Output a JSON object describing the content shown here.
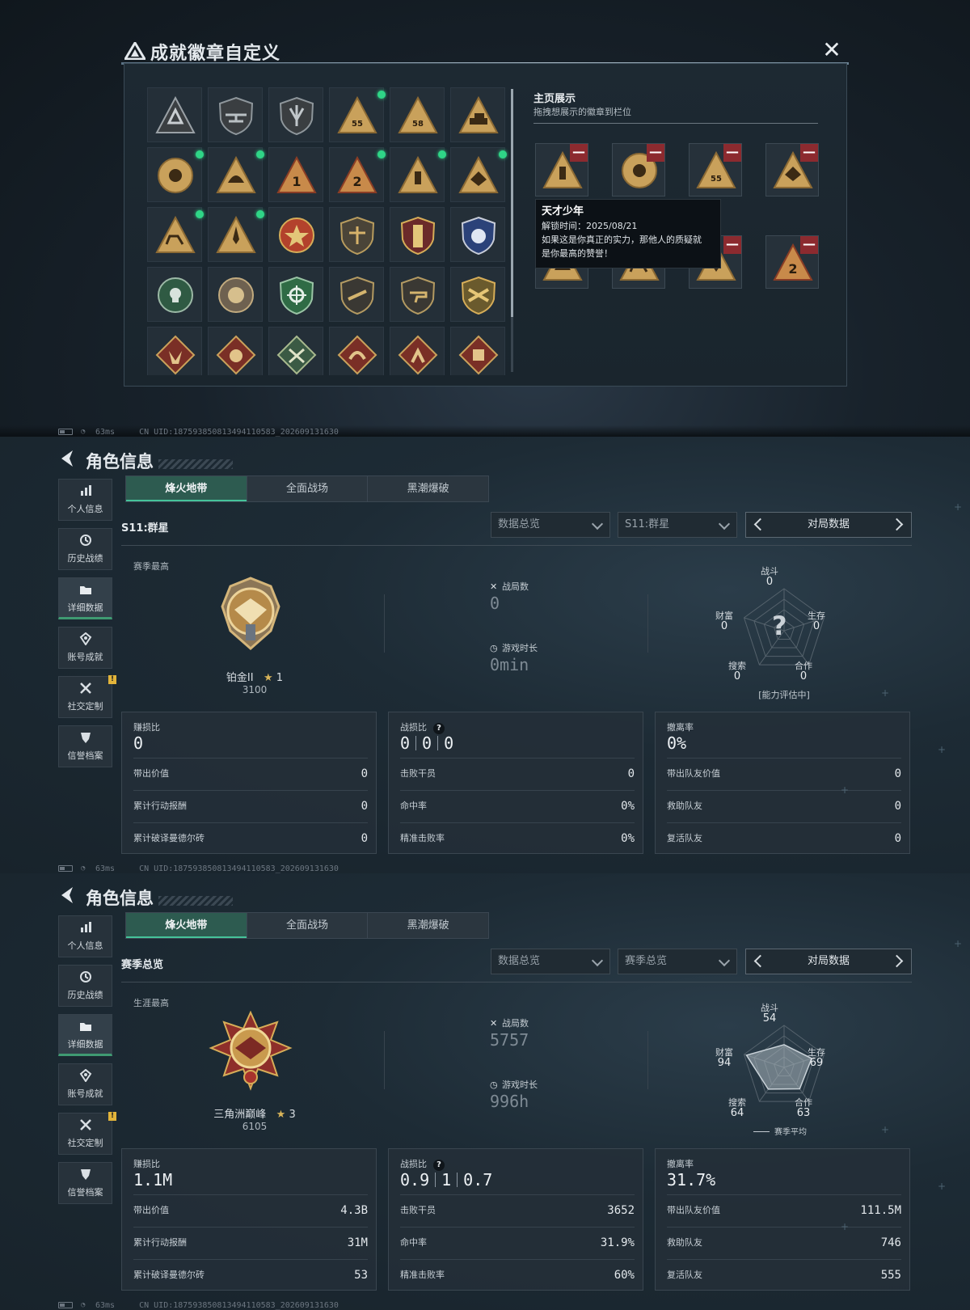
{
  "badge_modal": {
    "title": "成就徽章自定义",
    "showcase_title": "主页展示",
    "showcase_hint": "拖拽想展示的徽章到栏位",
    "tooltip": {
      "name": "天才少年",
      "unlock_time": "解锁时间：2025/08/21",
      "desc_line1": "如果这是你真正的实力，那他人的质疑就",
      "desc_line2": "是你最高的赞誉！"
    },
    "remove_glyph": "—",
    "badge_codes": {
      "b55": "55",
      "b58": "58",
      "b1": "1",
      "b2": "2"
    }
  },
  "status": {
    "ping": "63ms",
    "uid": "CN UID:187593850813494110583_202609131630"
  },
  "nav": [
    {
      "label": "个人信息",
      "icon": "bar-chart-icon"
    },
    {
      "label": "历史战绩",
      "icon": "clock-icon"
    },
    {
      "label": "详细数据",
      "icon": "folder-icon"
    },
    {
      "label": "账号成就",
      "icon": "medal-icon"
    },
    {
      "label": "社交定制",
      "icon": "tools-icon"
    },
    {
      "label": "信誉档案",
      "icon": "shield-icon"
    }
  ],
  "nav_badge": "!",
  "panel_title": "角色信息",
  "tabs": [
    "烽火地带",
    "全面战场",
    "黑潮爆破"
  ],
  "labels": {
    "battles": "战局数",
    "playtime": "游戏时长",
    "kd_hint": "?",
    "profit_ratio": "赚损比",
    "combat_ratio": "战损比",
    "extract_rate": "撤离率",
    "carried_value": "带出价值",
    "op_reward": "累计行动报酬",
    "mandel": "累计破译曼德尔砖",
    "kills": "击败干员",
    "hit_rate": "命中率",
    "headshot": "精准击败率",
    "team_value": "带出队友价值",
    "rescue": "救助队友",
    "revive": "复活队友",
    "pager_label": "对局数据",
    "dd_overview": "数据总览",
    "radar": {
      "combat": "战斗",
      "survive": "生存",
      "coop": "合作",
      "search": "搜索",
      "wealth": "财富"
    }
  },
  "panels": [
    {
      "subtitle": "S11:群星",
      "season_dd": "S11:群星",
      "rank_caption": "赛季最高",
      "rank_name": "铂金II",
      "stars": "1",
      "score": "3100",
      "battles": "0",
      "playtime": "0min",
      "radar": {
        "combat": "0",
        "survive": "0",
        "coop": "0",
        "search": "0",
        "wealth": "0"
      },
      "radar_center": "?",
      "radar_foot": "[能力评估中]",
      "profit_ratio": "0",
      "kd": [
        "0",
        "0",
        "0"
      ],
      "extract_rate": "0%",
      "carried_value": "0",
      "op_reward": "0",
      "mandel": "0",
      "kills": "0",
      "hit_rate": "0%",
      "headshot": "0%",
      "team_value": "0",
      "rescue": "0",
      "revive": "0"
    },
    {
      "subtitle": "赛季总览",
      "season_dd": "赛季总览",
      "rank_caption": "生涯最高",
      "rank_name": "三角洲巅峰",
      "stars": "3",
      "score": "6105",
      "battles": "5757",
      "playtime": "996h",
      "radar": {
        "combat": "54",
        "survive": "69",
        "coop": "63",
        "search": "64",
        "wealth": "94"
      },
      "radar_values": [
        0.54,
        0.69,
        0.63,
        0.64,
        0.94
      ],
      "legend": "赛季平均",
      "profit_ratio": "1.1M",
      "kd": [
        "0.9",
        "1",
        "0.7"
      ],
      "extract_rate": "31.7%",
      "carried_value": "4.3B",
      "op_reward": "31M",
      "mandel": "53",
      "kills": "3652",
      "hit_rate": "31.9%",
      "headshot": "60%",
      "team_value": "111.5M",
      "rescue": "746",
      "revive": "555"
    }
  ],
  "colors": {
    "accent": "#45c39a",
    "gold": "#d6ad58",
    "red_badge": "#8e3a2e",
    "green_dot": "#2fd587"
  }
}
